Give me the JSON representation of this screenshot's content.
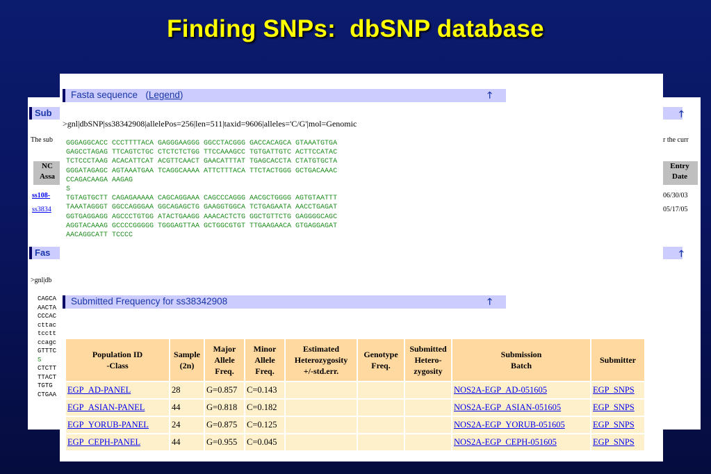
{
  "slide": {
    "title": "Finding SNPs:  dbSNP database"
  },
  "back_page": {
    "section1_title": "Sub",
    "description_start": "The sub",
    "description_end": "r the curr",
    "col_left_header_1": "NC",
    "col_left_header_2": "Assa",
    "col_right_header_1": "Entry",
    "col_right_header_2": "Date",
    "rows": [
      {
        "id": "ss108-",
        "date": "06/30/03"
      },
      {
        "id": "ss3834",
        "date": "05/17/05"
      }
    ],
    "section2_title": "Fas",
    "fasta_header_partial": ">gnl|db",
    "seq_partial": [
      "CAGCA",
      "AACTA",
      "CCCAC",
      "cttac",
      "tcctt",
      "ccagc",
      "GTTTC",
      "S",
      "CTCTT",
      "TTACT",
      "TGTG",
      "CTGAA"
    ]
  },
  "fasta_section": {
    "title": "Fasta sequence",
    "legend_open": "(",
    "legend_link": "Legend",
    "legend_close": ")",
    "header": ">gnl|dbSNP|ss38342908|allelePos=256|len=511|taxid=9606|alleles='C/G'|mol=Genomic",
    "sequence_lines": [
      "GGGAGGCACC CCCTTTTACA GAGGGAAGGG GGCCTACGGG GACCACAGCA GTAAATGTGA",
      "GAGCCTAGAG TTCAGTCTGC CTCTCTCTGG TTCCAAAGCC TGTGATTGTC ACTTCCATAC",
      "TCTCCCTAAG ACACATTCAT ACGTTCAACT GAACATTTAT TGAGCACCTA CTATGTGCTA",
      "GGGATAGAGC AGTAAATGAA TCAGGCAAAA ATTCTTTACA TTCTACTGGG GCTGACAAAC",
      "CCAGACAAGA AAGAG",
      "S",
      "TGTAGTGCTT CAGAGAAAAA CAGCAGGAAA CAGCCCAGGG AACGCTGGGG AGTGTAATTT",
      "TAAATAGGGT GGCCAGGGAA GGCAGAGCTG GAAGGTGGCA TCTGAGAATA AACCTGAGAT",
      "GGTGAGGAGG AGCCCTGTGG ATACTGAAGG AAACACTCTG GGCTGTTCTG GAGGGGCAGC",
      "AGGTACAAAG GCCCCGGGGG TGGGAGTTAA GCTGGCGTGT TTGAAGAACA GTGAGGAGAT",
      "AACAGGCATT TCCCC"
    ]
  },
  "frequency_section": {
    "title": "Submitted Frequency for ss38342908",
    "headers": [
      [
        "Population ID",
        "-Class"
      ],
      [
        "Sample",
        "(2n)"
      ],
      [
        "Major",
        "Allele",
        "Freq."
      ],
      [
        "Minor",
        "Allele",
        "Freq."
      ],
      [
        "Estimated",
        "Heterozygosity",
        "+/-std.err."
      ],
      [
        "Genotype",
        "Freq."
      ],
      [
        "Submitted",
        "Hetero-",
        "zygosity"
      ],
      [
        "Submission",
        "Batch"
      ],
      [
        "Submitter"
      ]
    ],
    "rows": [
      {
        "population": "EGP_AD-PANEL",
        "sample": "28",
        "major": "G=0.857",
        "minor": "C=0.143",
        "het": "",
        "genotype": "",
        "sub_het": "",
        "batch": "NOS2A-EGP_AD-051605",
        "submitter": "EGP_SNPS"
      },
      {
        "population": "EGP_ASIAN-PANEL",
        "sample": "44",
        "major": "G=0.818",
        "minor": "C=0.182",
        "het": "",
        "genotype": "",
        "sub_het": "",
        "batch": "NOS2A-EGP_ASIAN-051605",
        "submitter": "EGP_SNPS"
      },
      {
        "population": "EGP_YORUB-PANEL",
        "sample": "24",
        "major": "G=0.875",
        "minor": "C=0.125",
        "het": "",
        "genotype": "",
        "sub_het": "",
        "batch": "NOS2A-EGP_YORUB-051605",
        "submitter": "EGP_SNPS"
      },
      {
        "population": "EGP_CEPH-PANEL",
        "sample": "44",
        "major": "G=0.955",
        "minor": "C=0.045",
        "het": "",
        "genotype": "",
        "sub_het": "",
        "batch": "NOS2A-EGP_CEPH-051605",
        "submitter": "EGP_SNPS"
      }
    ]
  },
  "icons": {
    "arrow": "arrow-up-icon"
  },
  "colors": {
    "background": "#0a1560",
    "title": "#ffff00",
    "section_bar": "#ccccff",
    "header_cell": "#ffd9a0",
    "data_cell": "#fff0cc",
    "link": "#0000ee",
    "sequence": "#1b8a1b"
  }
}
